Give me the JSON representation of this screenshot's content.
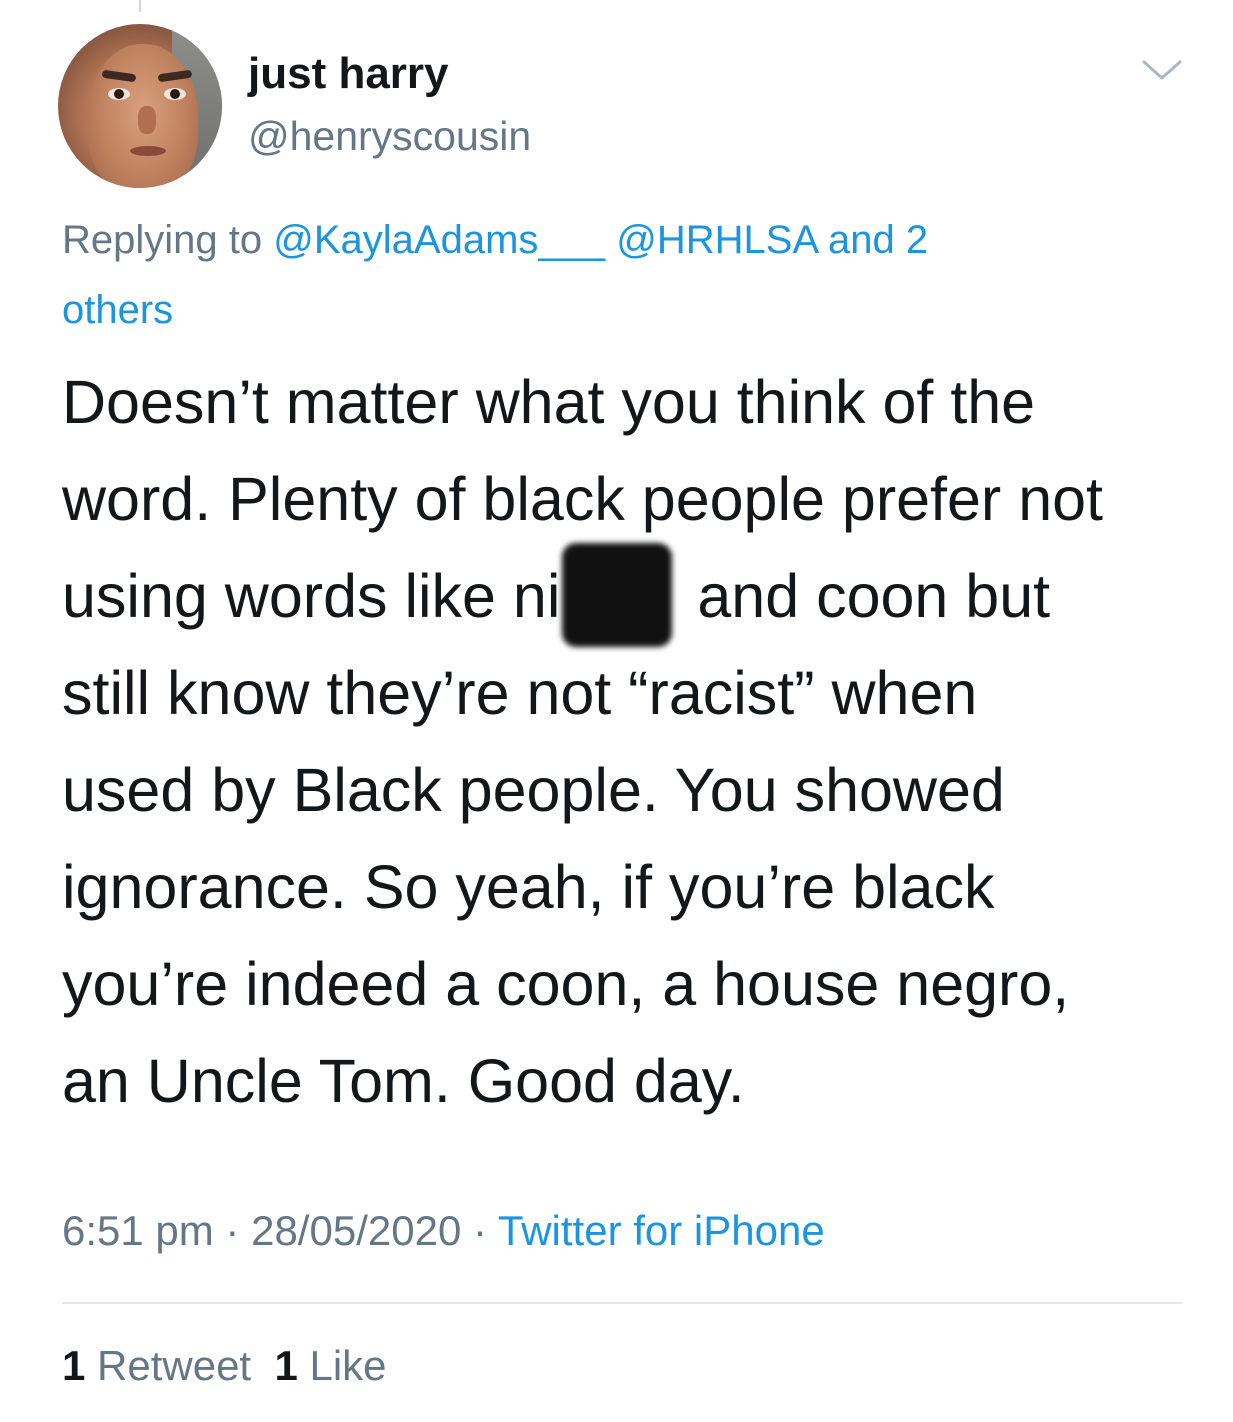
{
  "user": {
    "display_name": "just harry",
    "handle": "@henryscousin"
  },
  "reply": {
    "prefix": "Replying to ",
    "mention_1": "@KaylaAdams___",
    "mention_2": "@HRHLSA",
    "suffix_line1": " and 2",
    "line2": "others"
  },
  "tweet": {
    "line_1": "Doesn’t matter what you think of the",
    "line_2": "word. Plenty of black people prefer not",
    "line_3_before": "using words like ni",
    "line_3_after": " and coon but",
    "line_4": "still know they’re not “racist” when",
    "line_5": "used by Black people. You showed",
    "line_6": "ignorance. So yeah, if you’re black",
    "line_7": "you’re indeed a coon, a house negro,",
    "line_8": "an Uncle Tom. Good day."
  },
  "meta": {
    "time": "6:51 pm",
    "separator": " · ",
    "date": "28/05/2020",
    "source": "Twitter for iPhone"
  },
  "stats": {
    "retweet_count": "1",
    "retweet_label": " Retweet",
    "like_count": "1",
    "like_label": " Like"
  },
  "icons": {
    "menu": "chevron-down-icon",
    "avatar": "avatar"
  },
  "colors": {
    "text_primary": "#14171a",
    "text_secondary": "#657786",
    "link": "#1b95e0",
    "divider": "#e1e8ed"
  }
}
